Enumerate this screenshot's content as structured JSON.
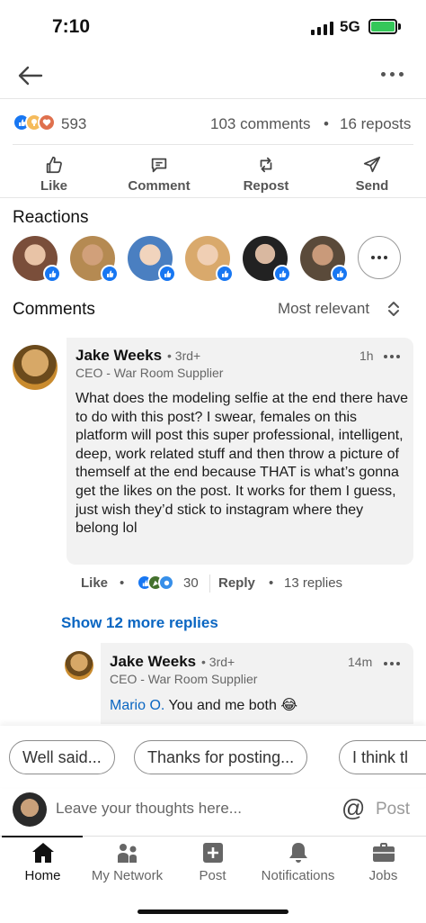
{
  "status_bar": {
    "time": "7:10",
    "network": "5G"
  },
  "post": {
    "reaction_icons": [
      "like-icon",
      "insightful-icon",
      "love-icon"
    ],
    "reaction_count": "593",
    "comments": "103 comments",
    "separator": "•",
    "reposts": "16 reposts"
  },
  "actions": {
    "like": "Like",
    "comment": "Comment",
    "repost": "Repost",
    "send": "Send"
  },
  "reactions": {
    "title": "Reactions",
    "avatar_colors": [
      "#b88a6c",
      "#c9a36b",
      "#4a7fc1",
      "#d9b38c",
      "#7a7a7a",
      "#6b5a4a"
    ]
  },
  "comments": {
    "title": "Comments",
    "sort_label": "Most relevant",
    "items": [
      {
        "author": "Jake Weeks",
        "degree": "• 3rd+",
        "time": "1h",
        "headline": "CEO - War Room Supplier",
        "body": "What does the modeling selfie at the end there have to do with this post? I swear, females on this platform will post this super professional, intelligent, deep, work related stuff and then throw a picture of themself at the end because THAT is what’s gonna get the likes on the post. It works for them I guess, just wish they’d stick to instagram where they belong lol",
        "like_label": "Like",
        "dot": "•",
        "reaction_count": "30",
        "reply_label": "Reply",
        "replies": "13 replies"
      }
    ],
    "show_more": "Show 12 more replies",
    "reply": {
      "author": "Jake Weeks",
      "degree": "• 3rd+",
      "time": "14m",
      "headline": "CEO - War Room Supplier",
      "mention": "Mario O.",
      "body": " You and me both 😂"
    }
  },
  "suggestions": [
    "Well said...",
    "Thanks for posting...",
    "I think tl"
  ],
  "composer": {
    "placeholder": "Leave your thoughts here...",
    "at_symbol": "@",
    "post_label": "Post"
  },
  "nav": {
    "home": "Home",
    "network": "My Network",
    "post": "Post",
    "notifications": "Notifications",
    "jobs": "Jobs"
  }
}
